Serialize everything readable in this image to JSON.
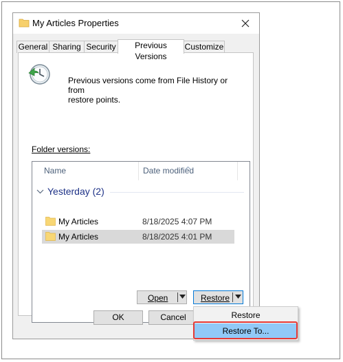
{
  "window": {
    "title": "My Articles Properties",
    "icons": {
      "title": "folder-icon",
      "close": "close-icon",
      "history": "history-clock-icon"
    }
  },
  "tabs": [
    {
      "label": "General"
    },
    {
      "label": "Sharing"
    },
    {
      "label": "Security"
    },
    {
      "label": "Previous Versions",
      "active": true
    },
    {
      "label": "Customize"
    }
  ],
  "panel": {
    "info_line1": "Previous versions come from File History or from",
    "info_line2": "restore points.",
    "folder_versions_label": "Folder versions:",
    "columns": {
      "name": "Name",
      "date": "Date modified"
    },
    "group": {
      "label": "Yesterday (2)"
    },
    "rows": [
      {
        "name": "My Articles",
        "date": "8/18/2025 4:07 PM",
        "selected": false
      },
      {
        "name": "My Articles",
        "date": "8/18/2025 4:01 PM",
        "selected": true
      }
    ],
    "buttons": {
      "open": "Open",
      "restore": "Restore"
    }
  },
  "dialog_buttons": {
    "ok": "OK",
    "cancel": "Cancel"
  },
  "dropdown_menu": {
    "items": [
      {
        "label": "Restore"
      },
      {
        "label": "Restore To...",
        "highlighted": true
      }
    ]
  },
  "colors": {
    "highlight": "#91c9f7",
    "callout": "#e53935",
    "group_text": "#1e3287",
    "selected_row": "#d9d9d9"
  }
}
